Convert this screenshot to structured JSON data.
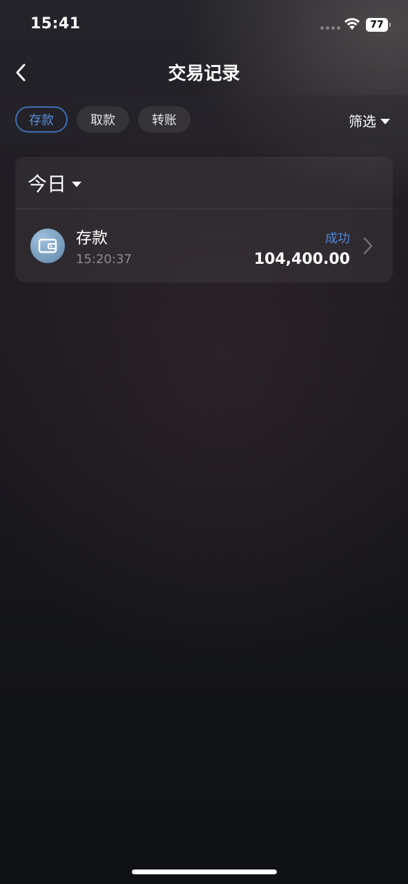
{
  "status_bar": {
    "time": "15:41",
    "battery": "77"
  },
  "header": {
    "title": "交易记录"
  },
  "tabs": [
    {
      "label": "存款",
      "active": true
    },
    {
      "label": "取款",
      "active": false
    },
    {
      "label": "转账",
      "active": false
    }
  ],
  "filter": {
    "label": "筛选"
  },
  "group": {
    "date_label": "今日",
    "records": [
      {
        "type": "存款",
        "time": "15:20:37",
        "status": "成功",
        "amount": "104,400.00",
        "icon": "wallet-icon"
      }
    ]
  },
  "colors": {
    "accent": "#5a8fd8",
    "status_success": "#4f86d6",
    "secondary_text": "#8c8c92"
  }
}
